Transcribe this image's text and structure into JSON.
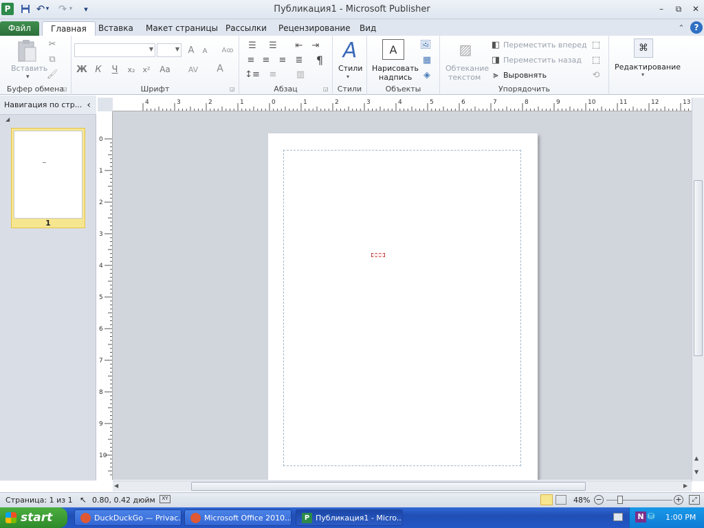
{
  "window": {
    "title": "Публикация1  -  Microsoft Publisher",
    "minimize": "–",
    "maximize": "⧉",
    "close": "✕"
  },
  "quick_access": {
    "app_icon": "P",
    "undo_icon": "↶",
    "redo_icon": "↷",
    "customize_icon": "▾"
  },
  "tabs": [
    {
      "label": "Файл"
    },
    {
      "label": "Главная"
    },
    {
      "label": "Вставка"
    },
    {
      "label": "Макет страницы"
    },
    {
      "label": "Рассылки"
    },
    {
      "label": "Рецензирование"
    },
    {
      "label": "Вид"
    }
  ],
  "ribbon": {
    "clipboard": {
      "label": "Буфер обмена",
      "paste": "Вставить"
    },
    "font": {
      "label": "Шрифт",
      "font_name": "",
      "font_size": "",
      "bold": "Ж",
      "italic": "К",
      "underline": "Ч",
      "subscript": "x₂",
      "superscript": "x²",
      "change_case": "Aa",
      "grow": "A",
      "shrink": "A",
      "font_color": "A"
    },
    "paragraph": {
      "label": "Абзац",
      "pilcrow": "¶"
    },
    "styles": {
      "label": "Стили",
      "button": "Стили"
    },
    "objects": {
      "label": "Объекты",
      "draw_textbox_line1": "Нарисовать",
      "draw_textbox_line2": "надпись"
    },
    "arrange": {
      "label": "Упорядочить",
      "wrap_line1": "Обтекание",
      "wrap_line2": "текстом",
      "bring_forward": "Переместить вперед",
      "send_backward": "Переместить назад",
      "align": "Выровнять"
    },
    "editing": {
      "label": "Редактирование"
    }
  },
  "nav_pane": {
    "title": "Навигация по стр...",
    "collapse_icon": "‹",
    "section_arrow": "◢",
    "pages": [
      {
        "number": "1"
      }
    ]
  },
  "rulers": {
    "horizontal": [
      "4",
      "3",
      "2",
      "1",
      "0",
      "1",
      "2",
      "3",
      "4",
      "5",
      "6",
      "7",
      "8",
      "9",
      "10",
      "11",
      "12",
      "13"
    ],
    "vertical": [
      "0",
      "1",
      "2",
      "3",
      "4",
      "5",
      "6",
      "7",
      "8",
      "9",
      "10"
    ]
  },
  "statusbar": {
    "page_info": "Страница: 1 из 1",
    "position": "0.80, 0.42 дюйм",
    "zoom": "48%"
  },
  "taskbar": {
    "start": "start",
    "tasks": [
      {
        "label": "DuckDuckGo — Privac..."
      },
      {
        "label": "Microsoft Office 2010..."
      },
      {
        "label": "Публикация1 - Micro..."
      }
    ],
    "clock": "1:00 PM"
  },
  "colors": {
    "file_tab": "#2c6f3a",
    "taskbar": "#2456c6",
    "start": "#2e8a2a",
    "thumb_selected": "#f7e690"
  }
}
